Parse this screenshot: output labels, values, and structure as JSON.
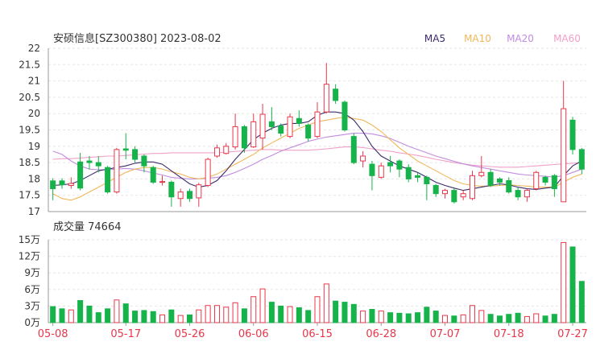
{
  "chart_data": [
    {
      "type": "candlestick",
      "title": "安硕信息[SZ300380] 2023-08-02",
      "ylim": [
        17,
        22
      ],
      "yticks": [
        "17",
        "17.5",
        "18",
        "18.5",
        "19",
        "19.5",
        "20",
        "20.5",
        "21",
        "21.5",
        "22"
      ],
      "grid": true,
      "legend_placement": "top-right",
      "legend": [
        {
          "label": "MA5",
          "color": "#3d2b6b"
        },
        {
          "label": "MA10",
          "color": "#f0b85a"
        },
        {
          "label": "MA20",
          "color": "#c28ce0"
        },
        {
          "label": "MA60",
          "color": "#f0a0c8"
        }
      ],
      "colors": {
        "up": "#e8374b",
        "down": "#16b34a"
      },
      "candles": [
        [
          17.94,
          17.7,
          18.02,
          17.35
        ],
        [
          17.94,
          17.82,
          18.02,
          17.7
        ],
        [
          17.8,
          17.86,
          18.05,
          17.7
        ],
        [
          18.52,
          17.72,
          18.8,
          17.65
        ],
        [
          18.55,
          18.5,
          18.7,
          18.3
        ],
        [
          18.5,
          18.4,
          18.7,
          18.2
        ],
        [
          18.35,
          17.6,
          18.4,
          17.55
        ],
        [
          17.6,
          18.9,
          18.95,
          17.55
        ],
        [
          18.92,
          18.88,
          19.4,
          18.6
        ],
        [
          18.9,
          18.6,
          19.0,
          18.5
        ],
        [
          18.7,
          18.4,
          18.75,
          18.2
        ],
        [
          18.35,
          17.9,
          18.4,
          17.85
        ],
        [
          17.92,
          17.92,
          18.1,
          17.8
        ],
        [
          17.9,
          17.45,
          17.95,
          17.15
        ],
        [
          17.4,
          17.6,
          17.7,
          17.15
        ],
        [
          17.62,
          17.4,
          17.7,
          17.3
        ],
        [
          17.42,
          17.82,
          17.88,
          17.15
        ],
        [
          17.8,
          18.6,
          18.65,
          17.75
        ],
        [
          18.7,
          18.95,
          19.05,
          18.65
        ],
        [
          18.78,
          19.0,
          19.1,
          18.75
        ],
        [
          18.98,
          19.6,
          20.0,
          18.9
        ],
        [
          19.6,
          18.95,
          19.65,
          18.8
        ],
        [
          18.98,
          19.75,
          20.0,
          18.95
        ],
        [
          19.25,
          19.98,
          20.3,
          18.9
        ],
        [
          19.75,
          19.6,
          20.2,
          19.5
        ],
        [
          19.62,
          19.4,
          19.7,
          19.3
        ],
        [
          19.3,
          19.9,
          20.0,
          19.25
        ],
        [
          19.85,
          19.7,
          20.1,
          19.6
        ],
        [
          19.65,
          19.25,
          19.7,
          19.15
        ],
        [
          19.3,
          20.05,
          20.35,
          19.25
        ],
        [
          20.05,
          20.9,
          21.55,
          20.0
        ],
        [
          20.75,
          20.4,
          20.9,
          20.3
        ],
        [
          20.35,
          19.5,
          20.4,
          19.45
        ],
        [
          19.3,
          18.5,
          19.4,
          18.45
        ],
        [
          18.55,
          18.7,
          18.85,
          18.35
        ],
        [
          18.45,
          18.1,
          18.55,
          17.65
        ],
        [
          18.05,
          18.4,
          18.5,
          18.0
        ],
        [
          18.5,
          18.4,
          18.7,
          18.2
        ],
        [
          18.55,
          18.3,
          18.6,
          18.05
        ],
        [
          18.35,
          18.0,
          18.45,
          17.9
        ],
        [
          18.1,
          18.05,
          18.2,
          17.9
        ],
        [
          18.05,
          17.85,
          18.1,
          17.35
        ],
        [
          17.8,
          17.55,
          17.85,
          17.45
        ],
        [
          17.55,
          17.65,
          17.7,
          17.4
        ],
        [
          17.65,
          17.3,
          17.7,
          17.25
        ],
        [
          17.45,
          17.55,
          17.65,
          17.35
        ],
        [
          17.4,
          18.1,
          18.25,
          17.35
        ],
        [
          18.1,
          18.2,
          18.7,
          18.05
        ],
        [
          18.2,
          17.8,
          18.3,
          17.75
        ],
        [
          18.0,
          17.9,
          18.05,
          17.8
        ],
        [
          17.95,
          17.6,
          18.05,
          17.55
        ],
        [
          17.65,
          17.45,
          17.75,
          17.35
        ],
        [
          17.45,
          17.65,
          17.7,
          17.3
        ],
        [
          17.7,
          18.2,
          18.25,
          17.65
        ],
        [
          18.05,
          17.9,
          18.1,
          17.8
        ],
        [
          18.1,
          17.7,
          18.15,
          17.45
        ],
        [
          17.3,
          20.15,
          21.0,
          17.3
        ],
        [
          19.8,
          18.9,
          19.9,
          18.75
        ],
        [
          18.9,
          18.3,
          18.95,
          18.15
        ]
      ],
      "ma": {
        "MA5": [
          17.8,
          17.82,
          17.85,
          17.95,
          18.1,
          18.25,
          18.3,
          18.35,
          18.4,
          18.48,
          18.52,
          18.52,
          18.45,
          18.25,
          18.05,
          17.85,
          17.75,
          17.8,
          17.95,
          18.25,
          18.6,
          18.9,
          19.2,
          19.4,
          19.55,
          19.65,
          19.7,
          19.7,
          19.75,
          19.95,
          20.05,
          20.05,
          20.0,
          19.8,
          19.45,
          19.0,
          18.7,
          18.55,
          18.4,
          18.3,
          18.2,
          18.05,
          17.9,
          17.8,
          17.72,
          17.65,
          17.7,
          17.75,
          17.8,
          17.85,
          17.82,
          17.75,
          17.7,
          17.68,
          17.72,
          17.75,
          18.1,
          18.4,
          18.55
        ],
        "MA10": [
          17.55,
          17.4,
          17.35,
          17.45,
          17.6,
          17.75,
          17.9,
          18.05,
          18.2,
          18.3,
          18.35,
          18.35,
          18.3,
          18.22,
          18.15,
          18.05,
          18.0,
          18.05,
          18.15,
          18.3,
          18.45,
          18.6,
          18.75,
          18.95,
          19.1,
          19.25,
          19.4,
          19.55,
          19.65,
          19.75,
          19.8,
          19.85,
          19.9,
          19.85,
          19.8,
          19.65,
          19.45,
          19.2,
          18.95,
          18.75,
          18.55,
          18.4,
          18.25,
          18.1,
          17.95,
          17.85,
          17.8,
          17.78,
          17.78,
          17.8,
          17.82,
          17.8,
          17.78,
          17.75,
          17.75,
          17.75,
          17.9,
          18.05,
          18.15
        ],
        "MA20": [
          18.85,
          18.75,
          18.55,
          18.4,
          18.3,
          18.28,
          18.28,
          18.3,
          18.32,
          18.3,
          18.25,
          18.18,
          18.12,
          18.05,
          18.02,
          18.0,
          18.0,
          18.02,
          18.05,
          18.1,
          18.2,
          18.32,
          18.45,
          18.6,
          18.72,
          18.85,
          18.95,
          19.05,
          19.15,
          19.22,
          19.28,
          19.32,
          19.36,
          19.4,
          19.4,
          19.38,
          19.32,
          19.24,
          19.12,
          19.0,
          18.9,
          18.8,
          18.7,
          18.62,
          18.54,
          18.46,
          18.4,
          18.35,
          18.3,
          18.25,
          18.2,
          18.15,
          18.12,
          18.1,
          18.08,
          18.06,
          18.1,
          18.2,
          18.3
        ],
        "MA60": [
          18.6,
          18.62,
          18.62,
          18.64,
          18.66,
          18.68,
          18.7,
          18.7,
          18.72,
          18.74,
          18.76,
          18.78,
          18.78,
          18.8,
          18.8,
          18.8,
          18.8,
          18.8,
          18.8,
          18.82,
          18.84,
          18.86,
          18.88,
          18.9,
          18.9,
          18.88,
          18.88,
          18.88,
          18.88,
          18.9,
          18.92,
          18.95,
          18.98,
          18.98,
          18.96,
          18.92,
          18.88,
          18.85,
          18.8,
          18.76,
          18.72,
          18.66,
          18.6,
          18.55,
          18.5,
          18.46,
          18.42,
          18.4,
          18.38,
          18.36,
          18.36,
          18.36,
          18.38,
          18.4,
          18.42,
          18.44,
          18.46,
          18.48,
          18.5
        ]
      }
    },
    {
      "type": "bar",
      "title": "成交量 74664",
      "ylim": [
        0,
        150000
      ],
      "yticks": [
        "0万",
        "3万",
        "6万",
        "9万",
        "12万",
        "15万"
      ],
      "xticks": [
        "05-08",
        "05-17",
        "05-26",
        "06-06",
        "06-15",
        "06-28",
        "07-07",
        "07-18",
        "07-27"
      ],
      "xtick_index": [
        0,
        8,
        15,
        22,
        29,
        36,
        43,
        50,
        57
      ],
      "volumes": [
        29000,
        25000,
        23000,
        40000,
        30000,
        18000,
        25000,
        41000,
        34000,
        21000,
        22000,
        20000,
        14000,
        23000,
        13000,
        14000,
        23000,
        31000,
        31000,
        28000,
        36000,
        25000,
        47000,
        61000,
        37000,
        30000,
        29000,
        27000,
        22000,
        47000,
        70000,
        39000,
        37000,
        33000,
        21000,
        24000,
        21000,
        18000,
        17000,
        16000,
        18000,
        28000,
        21000,
        13000,
        12000,
        14000,
        31000,
        22000,
        15000,
        12000,
        15000,
        17000,
        11000,
        16000,
        12000,
        15000,
        145000,
        137000,
        74664
      ]
    }
  ]
}
